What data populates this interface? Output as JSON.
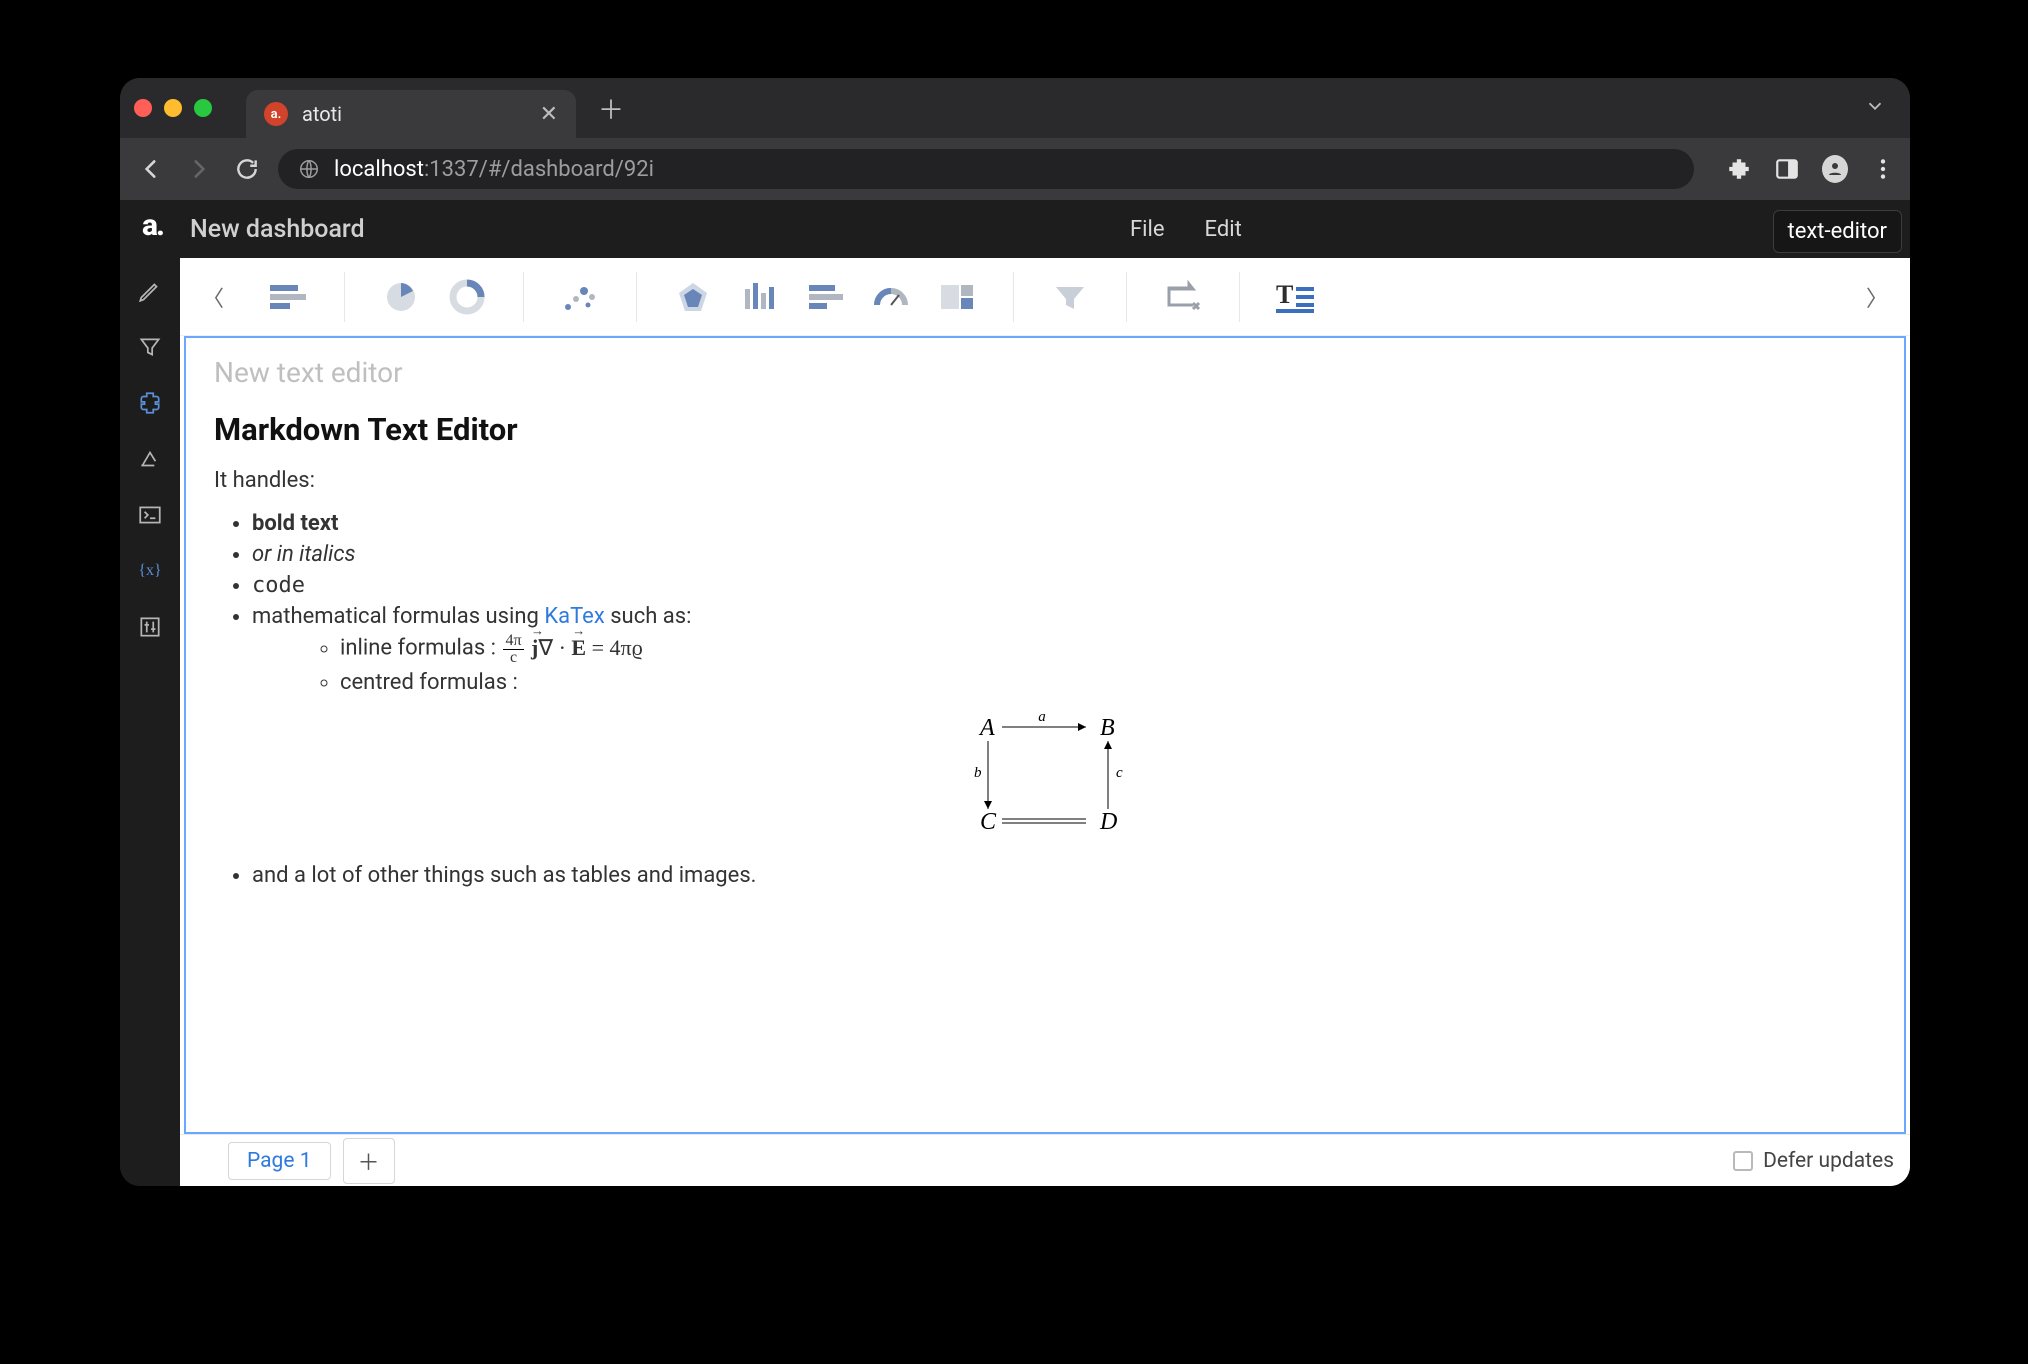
{
  "browser": {
    "tab_title": "atoti",
    "url_host": "localhost",
    "url_rest": ":1337/#/dashboard/92i"
  },
  "header": {
    "app_title": "New dashboard",
    "menus": [
      "File",
      "Edit"
    ],
    "tooltip": "text-editor"
  },
  "toolbar": {
    "active": "text-editor"
  },
  "editor": {
    "ghost_title": "New text editor",
    "heading": "Markdown Text Editor",
    "intro": "It handles:",
    "bullets": {
      "bold": "bold text",
      "italic": "or in italics",
      "code": "code",
      "math_prefix": "mathematical formulas using ",
      "math_link": "KaTex",
      "math_suffix": " such as:",
      "inline_label": "inline formulas : ",
      "centred_label": "centred formulas :",
      "other": "and a lot of other things such as tables and images."
    },
    "formula": {
      "frac_num": "4π",
      "frac_den": "c",
      "body": "j∇ · E = 4πϱ"
    },
    "diagram": {
      "A": "A",
      "B": "B",
      "C": "C",
      "D": "D",
      "a": "a",
      "b": "b",
      "c": "c"
    }
  },
  "footer": {
    "page_tab": "Page 1",
    "defer": "Defer updates"
  }
}
